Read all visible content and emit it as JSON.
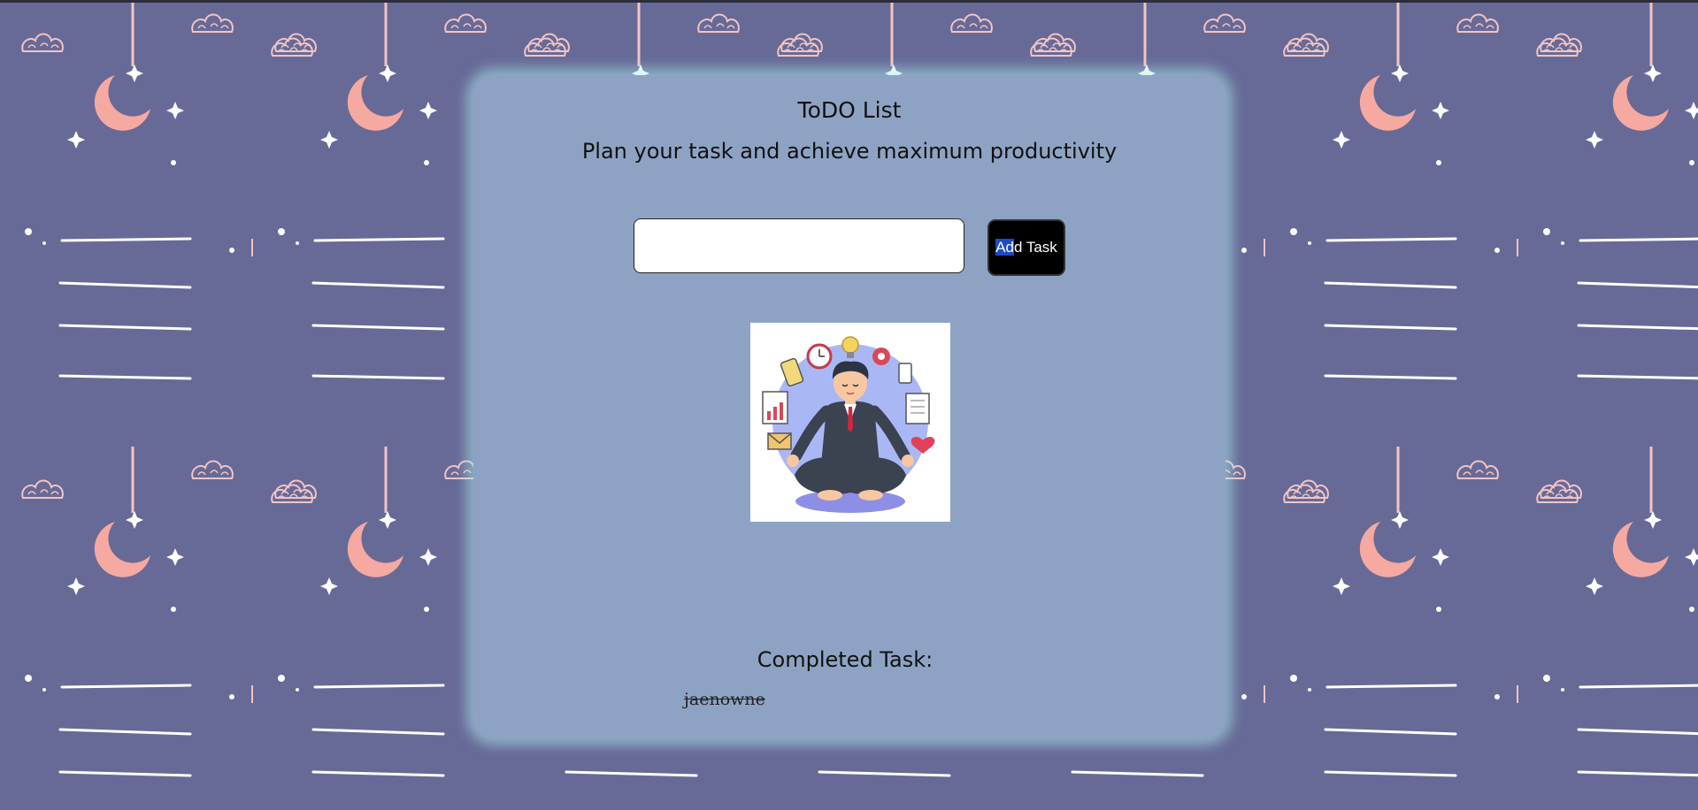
{
  "app": {
    "title": "ToDO List",
    "subtitle": "Plan your task and achieve maximum productivity"
  },
  "form": {
    "input_value": "",
    "add_button_label_highlight": "Ad",
    "add_button_label_rest": "d Task"
  },
  "completed": {
    "heading": "Completed Task:",
    "items": [
      "jaenowne"
    ]
  },
  "colors": {
    "background": "#676a97",
    "card": "#8ea3c4",
    "card_glow": "#ade8ec",
    "moon": "#f6a9a0",
    "button": "#000000"
  },
  "illustration": {
    "icon": "meditating-businessman-illustration"
  }
}
